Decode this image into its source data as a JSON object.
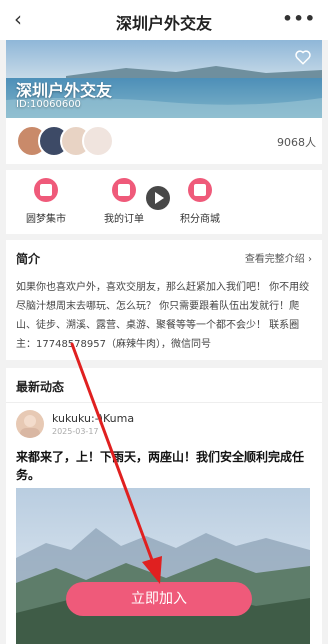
{
  "header": {
    "back_glyph": "‹",
    "title": "深圳户外交友",
    "more_glyph": "•••"
  },
  "banner": {
    "name": "深圳户外交友",
    "id_text": "ID:10060600"
  },
  "members": {
    "count_text": "9068人"
  },
  "quick_actions": [
    {
      "label": "圆梦集市",
      "icon": "shop-icon"
    },
    {
      "label": "我的订单",
      "icon": "order-icon"
    },
    {
      "label": "积分商城",
      "icon": "store-icon"
    }
  ],
  "intro": {
    "heading": "简介",
    "link_label": "查看完整介绍",
    "body": "如果你也喜欢户外，喜欢交朋友，那么赶紧加入我们吧！ 你不用绞尽脑汁想周末去哪玩、怎么玩？ 你只需要跟着队伍出发就行！爬山、徒步、溯溪、露营、桌游、聚餐等等一个都不会少！ 联系圈主：17748578957（麻辣牛肉），微信同号"
  },
  "feed": {
    "heading": "最新动态",
    "post": {
      "username": "kukuku:-)Kuma",
      "date": "2025-03-17",
      "text": "来都来了，上！下雨天，两座山！我们安全顺利完成任务。"
    }
  },
  "join_button": {
    "label": "立即加入"
  },
  "colors": {
    "accent": "#ef5a7a",
    "annotation_arrow": "#e02020"
  }
}
